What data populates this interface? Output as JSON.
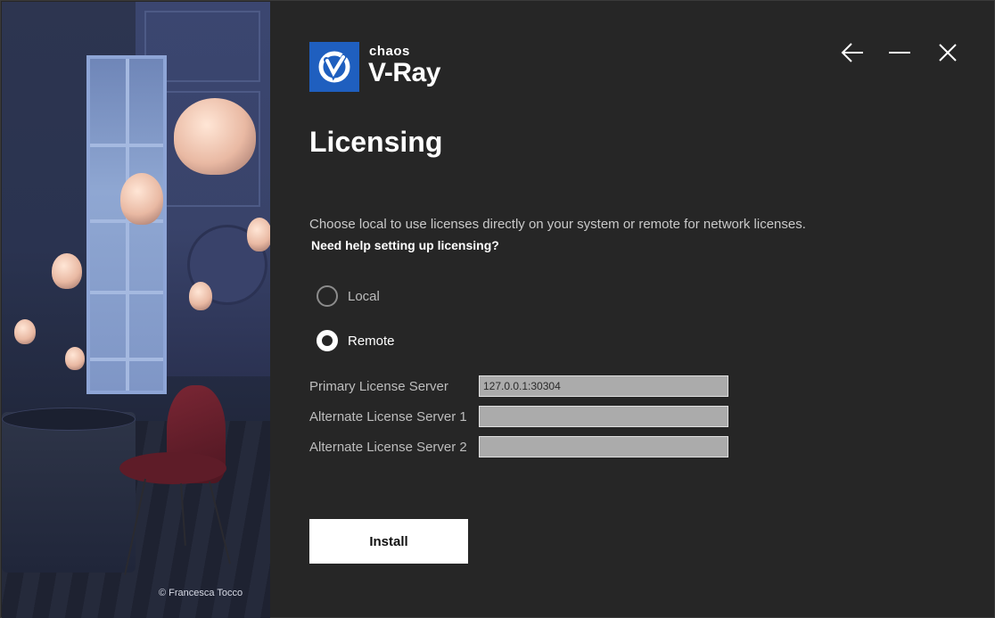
{
  "art": {
    "credit": "© Francesca Tocco"
  },
  "brand": {
    "company": "chaos",
    "product": "V-Ray",
    "logo_color": "#1f5fbf"
  },
  "window_controls": {
    "back_icon": "arrow-left-icon",
    "minimize_icon": "minimize-icon",
    "close_icon": "close-icon"
  },
  "page": {
    "title": "Licensing",
    "description": "Choose local to use licenses directly on your system or remote for network licenses.",
    "help_link": "Need help setting up licensing?"
  },
  "license_mode": {
    "options": [
      {
        "label": "Local",
        "selected": false
      },
      {
        "label": "Remote",
        "selected": true
      }
    ]
  },
  "servers": {
    "primary_label": "Primary License Server",
    "primary_value": "127.0.0.1:30304",
    "alternate1_label": "Alternate License Server 1",
    "alternate1_value": "",
    "alternate2_label": "Alternate License Server 2",
    "alternate2_value": ""
  },
  "actions": {
    "install_label": "Install"
  }
}
